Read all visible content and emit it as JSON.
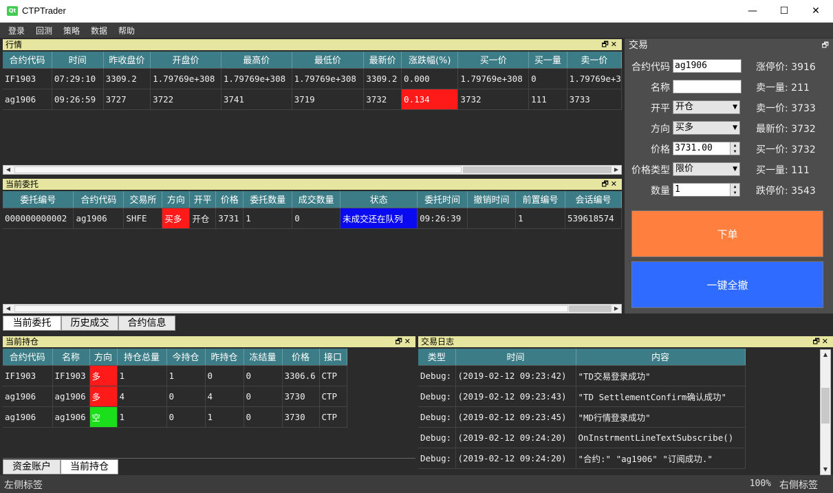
{
  "window": {
    "title": "CTPTrader",
    "app_icon_text": "Qt",
    "minimize": "—",
    "maximize": "☐",
    "close": "✕"
  },
  "menu": [
    "登录",
    "回测",
    "策略",
    "数据",
    "帮助"
  ],
  "dock_buttons": "🗗✕",
  "quotes": {
    "title": "行情",
    "headers": [
      "合约代码",
      "时间",
      "昨收盘价",
      "开盘价",
      "最高价",
      "最低价",
      "最新价",
      "涨跌幅(%)",
      "买一价",
      "买一量",
      "卖一价"
    ],
    "rows": [
      [
        "IF1903",
        "07:29:10",
        "3309.2",
        "1.79769e+308",
        "1.79769e+308",
        "1.79769e+308",
        "3309.2",
        "0.000",
        "1.79769e+308",
        "0",
        "1.79769e+3"
      ],
      [
        "ag1906",
        "09:26:59",
        "3727",
        "3722",
        "3741",
        "3719",
        "3732",
        "0.134",
        "3732",
        "111",
        "3733"
      ]
    ]
  },
  "orders": {
    "title": "当前委托",
    "headers": [
      "委托编号",
      "合约代码",
      "交易所",
      "方向",
      "开平",
      "价格",
      "委托数量",
      "成交数量",
      "状态",
      "委托时间",
      "撤销时间",
      "前置编号",
      "会话编号"
    ],
    "rows": [
      [
        "000000000002",
        "ag1906",
        "SHFE",
        "买多",
        "开仓",
        "3731",
        "1",
        "0",
        "未成交还在队列",
        "09:26:39",
        "",
        "1",
        "539618574"
      ]
    ],
    "tabs": [
      "当前委托",
      "历史成交",
      "合约信息"
    ]
  },
  "positions": {
    "title": "当前持仓",
    "headers": [
      "合约代码",
      "名称",
      "方向",
      "持仓总量",
      "今持仓",
      "昨持仓",
      "冻结量",
      "价格",
      "接口"
    ],
    "rows": [
      [
        "IF1903",
        "IF1903",
        "多",
        "1",
        "1",
        "0",
        "0",
        "3306.6",
        "CTP"
      ],
      [
        "ag1906",
        "ag1906",
        "多",
        "4",
        "0",
        "4",
        "0",
        "3730",
        "CTP"
      ],
      [
        "ag1906",
        "ag1906",
        "空",
        "1",
        "0",
        "1",
        "0",
        "3730",
        "CTP"
      ]
    ],
    "tabs": [
      "资金账户",
      "当前持仓"
    ]
  },
  "log": {
    "title": "交易日志",
    "headers": [
      "类型",
      "时间",
      "内容"
    ],
    "rows": [
      [
        "Debug:",
        "(2019-02-12 09:23:42)",
        "\"TD交易登录成功\""
      ],
      [
        "Debug:",
        "(2019-02-12 09:23:43)",
        "\"TD SettlementConfirm确认成功\""
      ],
      [
        "Debug:",
        "(2019-02-12 09:23:45)",
        "\"MD行情登录成功\""
      ],
      [
        "Debug:",
        "(2019-02-12 09:24:20)",
        "OnInstrmentLineTextSubscribe()"
      ],
      [
        "Debug:",
        "(2019-02-12 09:24:20)",
        "\"合约:\" \"ag1906\" \"订阅成功.\""
      ]
    ]
  },
  "trade": {
    "title": "交易",
    "labels": {
      "symbol": "合约代码",
      "name": "名称",
      "open_close": "开平",
      "direction": "方向",
      "price": "价格",
      "price_type": "价格类型",
      "quantity": "数量"
    },
    "values": {
      "symbol": "ag1906",
      "name": "",
      "open_close": "开仓",
      "direction": "买多",
      "price": "3731.00",
      "price_type": "限价",
      "quantity": "1"
    },
    "info": [
      "涨停价: 3916",
      "卖一量: 211",
      "卖一价: 3733",
      "最新价: 3732",
      "买一价: 3732",
      "买一量: 111",
      "跌停价: 3543"
    ],
    "order_button": "下单",
    "cancel_all_button": "一键全撤",
    "colors": {
      "order_button": "#ff7f3f",
      "cancel_all_button": "#2f6bff"
    }
  },
  "status": {
    "left": "左侧标签",
    "zoom": "100%",
    "right": "右侧标签"
  }
}
